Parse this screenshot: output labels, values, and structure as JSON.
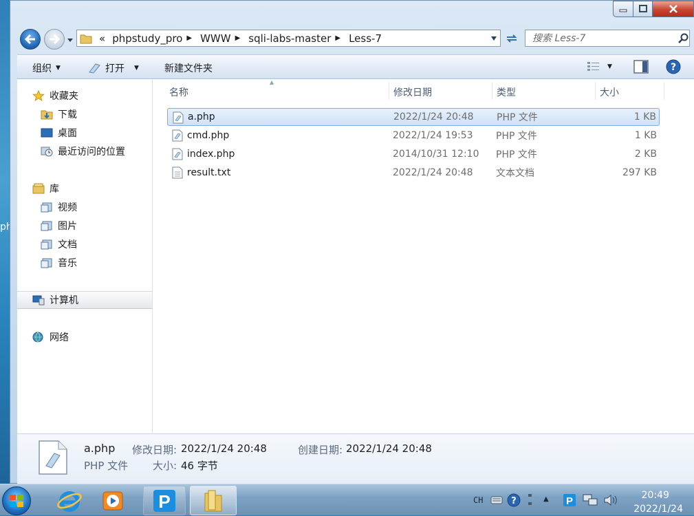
{
  "desktop": {
    "edge_text": "ph"
  },
  "window": {
    "address": {
      "overflow": "«",
      "crumbs": [
        "phpstudy_pro",
        "WWW",
        "sqli-labs-master",
        "Less-7"
      ]
    },
    "search": {
      "placeholder": "搜索 Less-7"
    },
    "toolbar": {
      "organize": "组织",
      "open": "打开",
      "new_folder": "新建文件夹"
    },
    "nav": {
      "favorites": "收藏夹",
      "downloads": "下载",
      "desktop": "桌面",
      "recent": "最近访问的位置",
      "libraries": "库",
      "videos": "视频",
      "pictures": "图片",
      "documents": "文档",
      "music": "音乐",
      "computer": "计算机",
      "network": "网络"
    },
    "columns": {
      "name": "名称",
      "modified": "修改日期",
      "type": "类型",
      "size": "大小"
    },
    "files": [
      {
        "name": "a.php",
        "modified": "2022/1/24 20:48",
        "type": "PHP 文件",
        "size": "1 KB"
      },
      {
        "name": "cmd.php",
        "modified": "2022/1/24 19:53",
        "type": "PHP 文件",
        "size": "1 KB"
      },
      {
        "name": "index.php",
        "modified": "2014/10/31 12:10",
        "type": "PHP 文件",
        "size": "2 KB"
      },
      {
        "name": "result.txt",
        "modified": "2022/1/24 20:48",
        "type": "文本文档",
        "size": "297 KB"
      }
    ],
    "details": {
      "name": "a.php",
      "type": "PHP 文件",
      "modified_label": "修改日期:",
      "modified_value": "2022/1/24 20:48",
      "size_label": "大小:",
      "size_value": "46 字节",
      "created_label": "创建日期:",
      "created_value": "2022/1/24 20:48"
    }
  },
  "taskbar": {
    "phpstudy_letter": "P",
    "tray_lang": "CH",
    "tray_phpstudy_letter": "P",
    "clock_time": "20:49",
    "clock_date": "2022/1/24"
  },
  "colors": {
    "accent_blue": "#1d62b0",
    "selection_border": "#84acdd",
    "close_red": "#c94532"
  }
}
